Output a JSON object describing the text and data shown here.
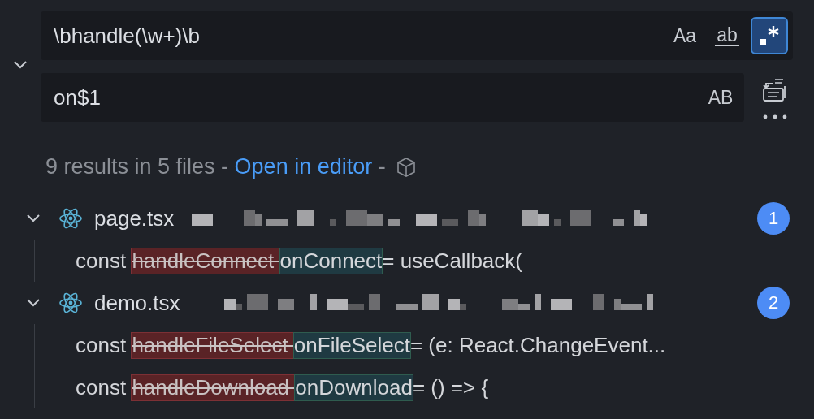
{
  "search": {
    "expanded": true,
    "find": {
      "value": "\\bhandle(\\w+)\\b",
      "toggles": [
        {
          "kind": "text",
          "label": "Aa",
          "selected": false
        },
        {
          "kind": "word",
          "label": "ab",
          "selected": false
        },
        {
          "kind": "regex",
          "selected": true
        }
      ]
    },
    "replace": {
      "value": "on$1",
      "toggles": [
        {
          "kind": "text",
          "label": "AB",
          "selected": false
        }
      ]
    }
  },
  "summary": {
    "text": "9 results in 5 files - ",
    "link": "Open in editor",
    "separator": " -"
  },
  "files": [
    {
      "name": "page.tsx",
      "expanded": true,
      "count": "1",
      "matches": [
        {
          "prefix": "const ",
          "removed": "handleConnect ",
          "inserted": "onConnect",
          "suffix": "= useCallback("
        }
      ]
    },
    {
      "name": "demo.tsx",
      "expanded": true,
      "count": "2",
      "matches": [
        {
          "prefix": "const ",
          "removed": "handleFileSelect ",
          "inserted": "onFileSelect",
          "suffix": "= (e: React.ChangeEvent..."
        },
        {
          "prefix": "const ",
          "removed": "handleDownload ",
          "inserted": "onDownload",
          "suffix": "= () => {"
        }
      ]
    }
  ]
}
